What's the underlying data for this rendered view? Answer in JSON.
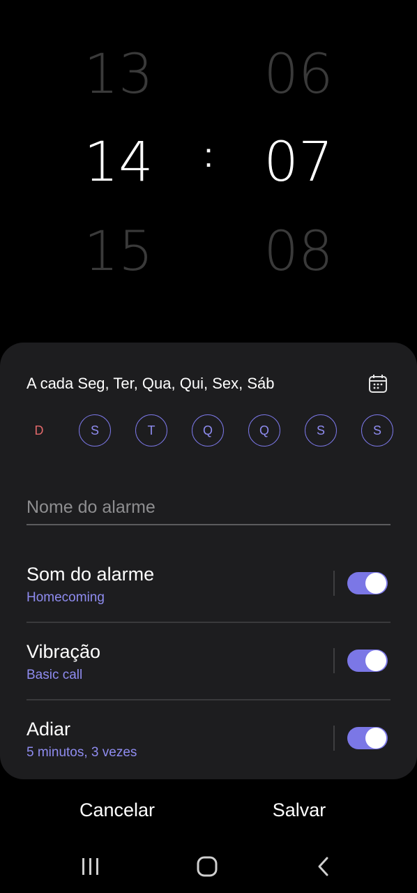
{
  "time_picker": {
    "hours": {
      "prev": "13",
      "current": "14",
      "next": "15"
    },
    "minutes": {
      "prev": "06",
      "current": "07",
      "next": "08"
    },
    "separator": ":"
  },
  "repeat": {
    "text": "A cada Seg, Ter, Qua, Qui, Sex, Sáb",
    "days": [
      {
        "label": "D",
        "selected": false
      },
      {
        "label": "S",
        "selected": true
      },
      {
        "label": "T",
        "selected": true
      },
      {
        "label": "Q",
        "selected": true
      },
      {
        "label": "Q",
        "selected": true
      },
      {
        "label": "S",
        "selected": true
      },
      {
        "label": "S",
        "selected": true
      }
    ]
  },
  "alarm_name": {
    "placeholder": "Nome do alarme",
    "value": ""
  },
  "settings": [
    {
      "title": "Som do alarme",
      "subtitle": "Homecoming",
      "enabled": true
    },
    {
      "title": "Vibração",
      "subtitle": "Basic call",
      "enabled": true
    },
    {
      "title": "Adiar",
      "subtitle": "5 minutos, 3 vezes",
      "enabled": true
    }
  ],
  "actions": {
    "cancel": "Cancelar",
    "save": "Salvar"
  },
  "colors": {
    "accent": "#7b77e6",
    "sunday": "#e0686a",
    "card": "#1d1d1f",
    "background": "#000000"
  }
}
